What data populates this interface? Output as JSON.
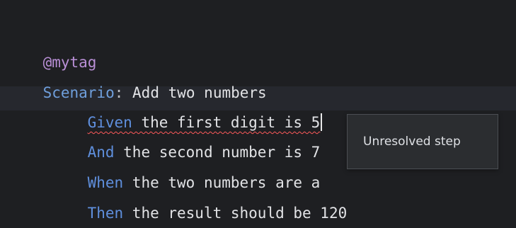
{
  "editor": {
    "lines": [
      {
        "tag": "@mytag"
      },
      {
        "keyword": "Scenario",
        "colon": ":",
        "text": " Add two numbers"
      },
      {
        "keyword": "Given",
        "text": " the first digit is 5"
      },
      {
        "keyword": "And",
        "text": " the second number is 7"
      },
      {
        "keyword": "When",
        "text": " the two numbers are a"
      },
      {
        "keyword": "Then",
        "text": " the result should be 120"
      }
    ]
  },
  "tooltip": {
    "message": "Unresolved step"
  },
  "colors": {
    "background": "#1e1f22",
    "tag": "#b98fd6",
    "keyword": "#5f8fdd",
    "text": "#e2e3e6",
    "error_underline": "#ff5a5a"
  }
}
